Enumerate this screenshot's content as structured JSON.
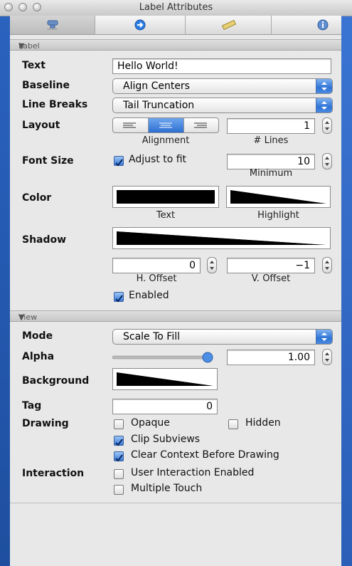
{
  "window": {
    "title": "Label Attributes"
  },
  "toolbar": {
    "tabs": [
      {
        "icon": "attributes-icon",
        "selected": true
      },
      {
        "icon": "connections-icon",
        "selected": false
      },
      {
        "icon": "size-ruler-icon",
        "selected": false
      },
      {
        "icon": "info-icon",
        "selected": false
      }
    ]
  },
  "label_section": {
    "header": "Label",
    "text_label": "Text",
    "text_value": "Hello World!",
    "baseline_label": "Baseline",
    "baseline_value": "Align Centers",
    "linebreaks_label": "Line Breaks",
    "linebreaks_value": "Tail Truncation",
    "layout_label": "Layout",
    "alignment_caption": "Alignment",
    "lines_value": "1",
    "lines_caption": "# Lines",
    "fontsize_label": "Font Size",
    "adjust_label": "Adjust to fit",
    "adjust_checked": true,
    "minimum_value": "10",
    "minimum_caption": "Minimum",
    "color_label": "Color",
    "text_caption": "Text",
    "highlight_caption": "Highlight",
    "shadow_label": "Shadow",
    "hoffset_value": "0",
    "hoffset_caption": "H. Offset",
    "voffset_value": "−1",
    "voffset_caption": "V. Offset",
    "enabled_label": "Enabled",
    "enabled_checked": true
  },
  "view_section": {
    "header": "View",
    "mode_label": "Mode",
    "mode_value": "Scale To Fill",
    "alpha_label": "Alpha",
    "alpha_value": "1.00",
    "background_label": "Background",
    "tag_label": "Tag",
    "tag_value": "0",
    "drawing_label": "Drawing",
    "opaque_label": "Opaque",
    "hidden_label": "Hidden",
    "clip_label": "Clip Subviews",
    "clear_label": "Clear Context Before Drawing",
    "interaction_label": "Interaction",
    "user_interaction_label": "User Interaction Enabled",
    "multiple_touch_label": "Multiple Touch"
  },
  "colors": {
    "accent": "#2f74d6",
    "desktop": "#2f63b6"
  }
}
